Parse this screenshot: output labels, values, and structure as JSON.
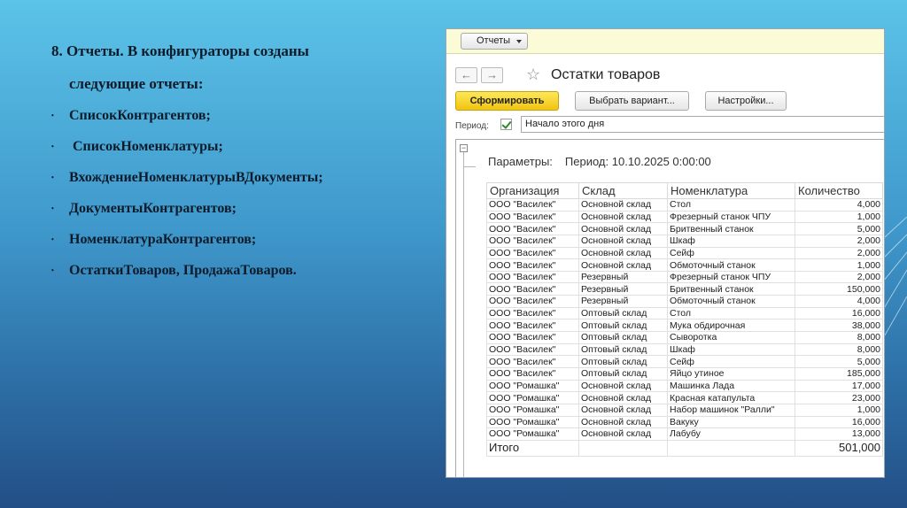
{
  "slide": {
    "title_line1": "8. Отчеты. В конфигураторы созданы",
    "title_line2": "следующие отчеты:",
    "bullets": [
      "СписокКонтрагентов;",
      "СписокНоменклатуры;",
      "ВхождениеНоменклатурыВДокументы;",
      "ДокументыКонтрагентов;",
      "НоменклатураКонтрагентов;",
      "ОстаткиТоваров, ПродажаТоваров."
    ]
  },
  "app": {
    "reports_button": "Отчеты",
    "nav_back": "←",
    "nav_forward": "→",
    "title": "Остатки товаров",
    "toolbar": {
      "generate": "Сформировать",
      "choose_variant": "Выбрать вариант...",
      "settings": "Настройки..."
    },
    "period": {
      "label": "Период:",
      "value": "Начало этого дня"
    },
    "report": {
      "params_label": "Параметры:",
      "params_value": "Период: 10.10.2025 0:00:00",
      "columns": [
        "Организация",
        "Склад",
        "Номенклатура",
        "Количество"
      ],
      "rows": [
        [
          "ООО \"Василек\"",
          "Основной склад",
          "Стол",
          "4,000"
        ],
        [
          "ООО \"Василек\"",
          "Основной склад",
          "Фрезерный станок ЧПУ",
          "1,000"
        ],
        [
          "ООО \"Василек\"",
          "Основной склад",
          "Бритвенный станок",
          "5,000"
        ],
        [
          "ООО \"Василек\"",
          "Основной склад",
          "Шкаф",
          "2,000"
        ],
        [
          "ООО \"Василек\"",
          "Основной склад",
          "Сейф",
          "2,000"
        ],
        [
          "ООО \"Василек\"",
          "Основной склад",
          "Обмоточный станок",
          "1,000"
        ],
        [
          "ООО \"Василек\"",
          "Резервный",
          "Фрезерный станок ЧПУ",
          "2,000"
        ],
        [
          "ООО \"Василек\"",
          "Резервный",
          "Бритвенный станок",
          "150,000"
        ],
        [
          "ООО \"Василек\"",
          "Резервный",
          "Обмоточный станок",
          "4,000"
        ],
        [
          "ООО \"Василек\"",
          "Оптовый склад",
          "Стол",
          "16,000"
        ],
        [
          "ООО \"Василек\"",
          "Оптовый склад",
          "Мука обдирочная",
          "38,000"
        ],
        [
          "ООО \"Василек\"",
          "Оптовый склад",
          "Сыворотка",
          "8,000"
        ],
        [
          "ООО \"Василек\"",
          "Оптовый склад",
          "Шкаф",
          "8,000"
        ],
        [
          "ООО \"Василек\"",
          "Оптовый склад",
          "Сейф",
          "5,000"
        ],
        [
          "ООО \"Василек\"",
          "Оптовый склад",
          "Яйцо утиное",
          "185,000"
        ],
        [
          "ООО \"Ромашка\"",
          "Основной склад",
          "Машинка Лада",
          "17,000"
        ],
        [
          "ООО \"Ромашка\"",
          "Основной склад",
          "Красная катапульта",
          "23,000"
        ],
        [
          "ООО \"Ромашка\"",
          "Основной склад",
          "Набор машинок \"Ралли\"",
          "1,000"
        ],
        [
          "ООО \"Ромашка\"",
          "Основной склад",
          "Вакуку",
          "16,000"
        ],
        [
          "ООО \"Ромашка\"",
          "Основной склад",
          "Лабубу",
          "13,000"
        ]
      ],
      "total_label": "Итого",
      "total_value": "501,000"
    }
  }
}
